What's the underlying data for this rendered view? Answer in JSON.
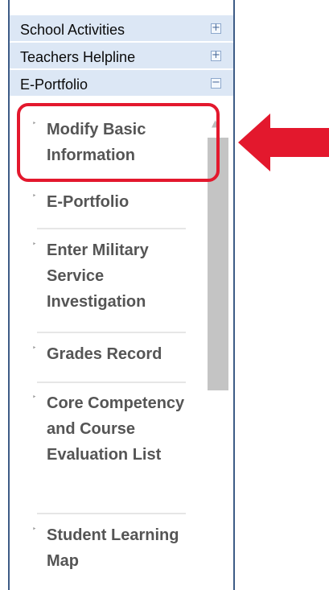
{
  "accordion": [
    {
      "title": "School Activities",
      "toggle": "+"
    },
    {
      "title": "Teachers Helpline",
      "toggle": "+"
    },
    {
      "title": "E-Portfolio",
      "toggle": "−"
    }
  ],
  "submenu": {
    "bullet": "‣",
    "items": [
      {
        "label": "Modify Basic Information"
      },
      {
        "label": "E-Portfolio"
      },
      {
        "label": "Enter Military Service Investigation"
      },
      {
        "label": "Grades Record"
      },
      {
        "label": "Core Competency and Course Evaluation List"
      },
      {
        "label": "Student Learning Map"
      }
    ]
  },
  "scrollbar": {
    "up_arrow": "▲"
  },
  "colors": {
    "header_bg": "#dce7f5",
    "frame": "#3d5b86",
    "annotation_red": "#e3182d",
    "menu_text": "#555555",
    "scroll_thumb": "#c4c4c4"
  }
}
